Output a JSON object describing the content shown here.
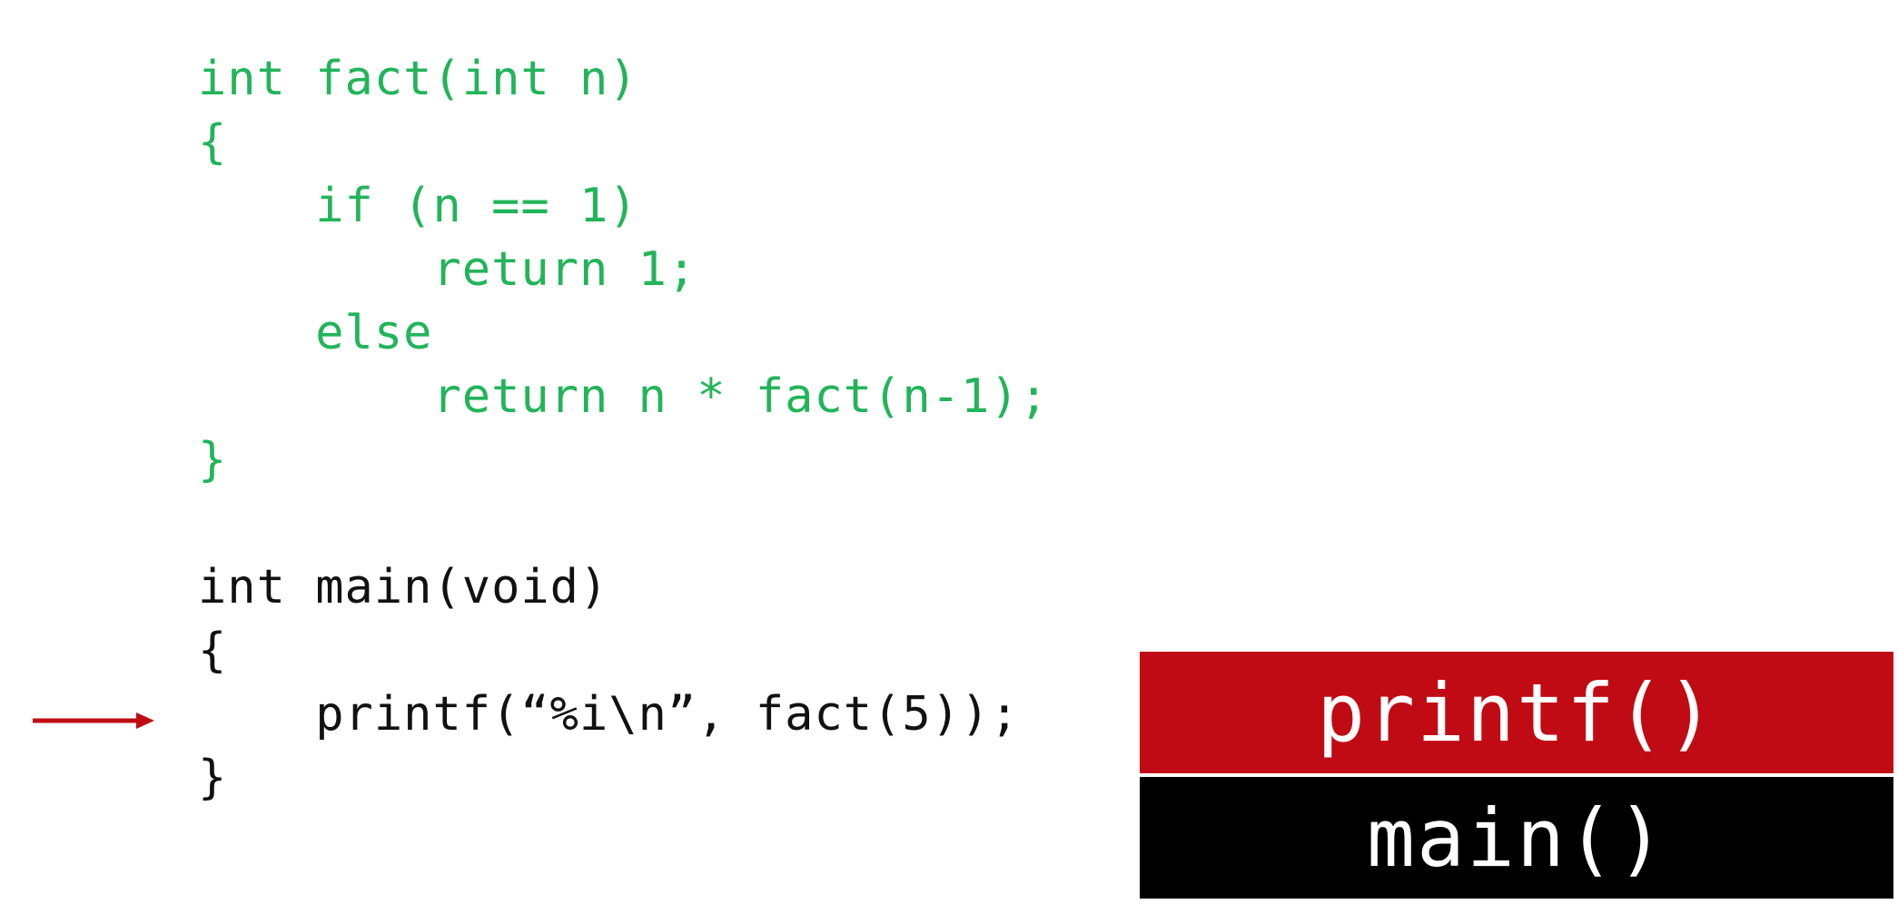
{
  "code": {
    "lines": [
      "int fact(int n)",
      "{",
      "    if (n == 1)",
      "        return 1;",
      "    else",
      "        return n * fact(n-1);",
      "}",
      "",
      "int main(void)",
      "{",
      "    printf(“%i\\n”, fact(5));",
      "}"
    ]
  },
  "stack": {
    "frames": [
      "printf()",
      "main()"
    ]
  },
  "colors": {
    "fact_code": "#22b45a",
    "main_code": "#111111",
    "arrow": "#c00a14",
    "top_frame": "#c00a14",
    "bottom_frame": "#000000"
  },
  "icons": {
    "arrow": "right-arrow-icon"
  }
}
